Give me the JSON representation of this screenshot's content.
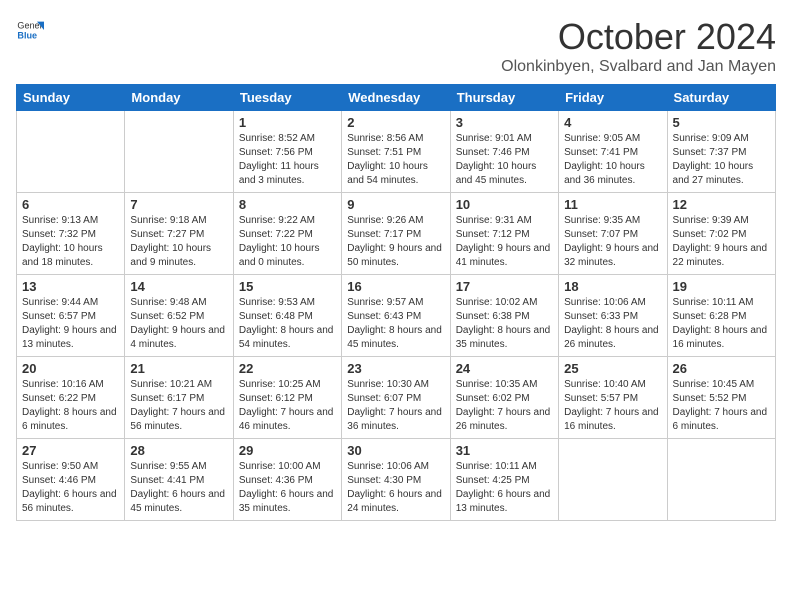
{
  "header": {
    "logo_general": "General",
    "logo_blue": "Blue",
    "month_title": "October 2024",
    "location": "Olonkinbyen, Svalbard and Jan Mayen"
  },
  "days_of_week": [
    "Sunday",
    "Monday",
    "Tuesday",
    "Wednesday",
    "Thursday",
    "Friday",
    "Saturday"
  ],
  "weeks": [
    [
      {
        "day": "",
        "info": ""
      },
      {
        "day": "",
        "info": ""
      },
      {
        "day": "1",
        "info": "Sunrise: 8:52 AM\nSunset: 7:56 PM\nDaylight: 11 hours and 3 minutes."
      },
      {
        "day": "2",
        "info": "Sunrise: 8:56 AM\nSunset: 7:51 PM\nDaylight: 10 hours and 54 minutes."
      },
      {
        "day": "3",
        "info": "Sunrise: 9:01 AM\nSunset: 7:46 PM\nDaylight: 10 hours and 45 minutes."
      },
      {
        "day": "4",
        "info": "Sunrise: 9:05 AM\nSunset: 7:41 PM\nDaylight: 10 hours and 36 minutes."
      },
      {
        "day": "5",
        "info": "Sunrise: 9:09 AM\nSunset: 7:37 PM\nDaylight: 10 hours and 27 minutes."
      }
    ],
    [
      {
        "day": "6",
        "info": "Sunrise: 9:13 AM\nSunset: 7:32 PM\nDaylight: 10 hours and 18 minutes."
      },
      {
        "day": "7",
        "info": "Sunrise: 9:18 AM\nSunset: 7:27 PM\nDaylight: 10 hours and 9 minutes."
      },
      {
        "day": "8",
        "info": "Sunrise: 9:22 AM\nSunset: 7:22 PM\nDaylight: 10 hours and 0 minutes."
      },
      {
        "day": "9",
        "info": "Sunrise: 9:26 AM\nSunset: 7:17 PM\nDaylight: 9 hours and 50 minutes."
      },
      {
        "day": "10",
        "info": "Sunrise: 9:31 AM\nSunset: 7:12 PM\nDaylight: 9 hours and 41 minutes."
      },
      {
        "day": "11",
        "info": "Sunrise: 9:35 AM\nSunset: 7:07 PM\nDaylight: 9 hours and 32 minutes."
      },
      {
        "day": "12",
        "info": "Sunrise: 9:39 AM\nSunset: 7:02 PM\nDaylight: 9 hours and 22 minutes."
      }
    ],
    [
      {
        "day": "13",
        "info": "Sunrise: 9:44 AM\nSunset: 6:57 PM\nDaylight: 9 hours and 13 minutes."
      },
      {
        "day": "14",
        "info": "Sunrise: 9:48 AM\nSunset: 6:52 PM\nDaylight: 9 hours and 4 minutes."
      },
      {
        "day": "15",
        "info": "Sunrise: 9:53 AM\nSunset: 6:48 PM\nDaylight: 8 hours and 54 minutes."
      },
      {
        "day": "16",
        "info": "Sunrise: 9:57 AM\nSunset: 6:43 PM\nDaylight: 8 hours and 45 minutes."
      },
      {
        "day": "17",
        "info": "Sunrise: 10:02 AM\nSunset: 6:38 PM\nDaylight: 8 hours and 35 minutes."
      },
      {
        "day": "18",
        "info": "Sunrise: 10:06 AM\nSunset: 6:33 PM\nDaylight: 8 hours and 26 minutes."
      },
      {
        "day": "19",
        "info": "Sunrise: 10:11 AM\nSunset: 6:28 PM\nDaylight: 8 hours and 16 minutes."
      }
    ],
    [
      {
        "day": "20",
        "info": "Sunrise: 10:16 AM\nSunset: 6:22 PM\nDaylight: 8 hours and 6 minutes."
      },
      {
        "day": "21",
        "info": "Sunrise: 10:21 AM\nSunset: 6:17 PM\nDaylight: 7 hours and 56 minutes."
      },
      {
        "day": "22",
        "info": "Sunrise: 10:25 AM\nSunset: 6:12 PM\nDaylight: 7 hours and 46 minutes."
      },
      {
        "day": "23",
        "info": "Sunrise: 10:30 AM\nSunset: 6:07 PM\nDaylight: 7 hours and 36 minutes."
      },
      {
        "day": "24",
        "info": "Sunrise: 10:35 AM\nSunset: 6:02 PM\nDaylight: 7 hours and 26 minutes."
      },
      {
        "day": "25",
        "info": "Sunrise: 10:40 AM\nSunset: 5:57 PM\nDaylight: 7 hours and 16 minutes."
      },
      {
        "day": "26",
        "info": "Sunrise: 10:45 AM\nSunset: 5:52 PM\nDaylight: 7 hours and 6 minutes."
      }
    ],
    [
      {
        "day": "27",
        "info": "Sunrise: 9:50 AM\nSunset: 4:46 PM\nDaylight: 6 hours and 56 minutes."
      },
      {
        "day": "28",
        "info": "Sunrise: 9:55 AM\nSunset: 4:41 PM\nDaylight: 6 hours and 45 minutes."
      },
      {
        "day": "29",
        "info": "Sunrise: 10:00 AM\nSunset: 4:36 PM\nDaylight: 6 hours and 35 minutes."
      },
      {
        "day": "30",
        "info": "Sunrise: 10:06 AM\nSunset: 4:30 PM\nDaylight: 6 hours and 24 minutes."
      },
      {
        "day": "31",
        "info": "Sunrise: 10:11 AM\nSunset: 4:25 PM\nDaylight: 6 hours and 13 minutes."
      },
      {
        "day": "",
        "info": ""
      },
      {
        "day": "",
        "info": ""
      }
    ]
  ]
}
